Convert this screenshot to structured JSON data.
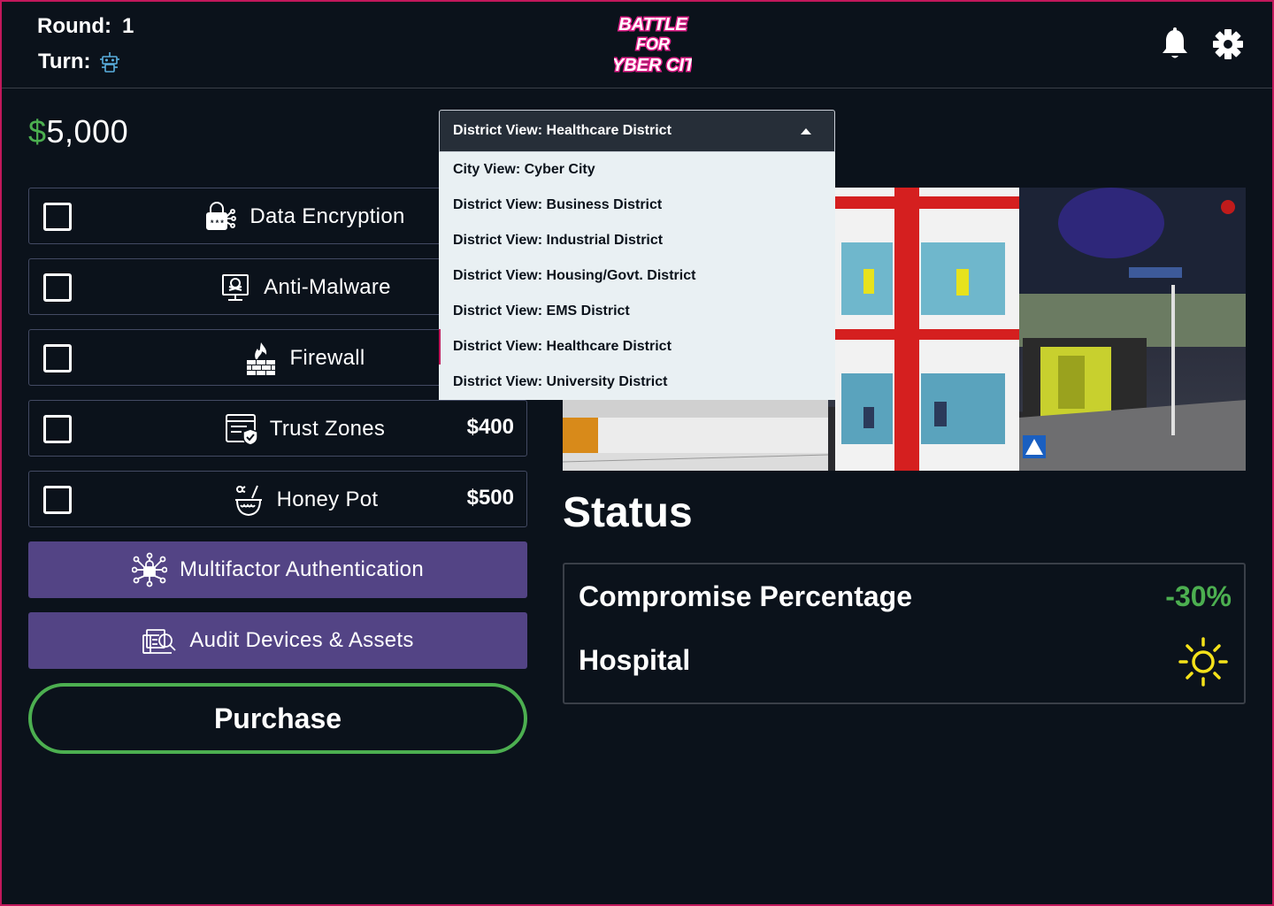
{
  "header": {
    "round_label": "Round:",
    "round_value": "1",
    "turn_label": "Turn:",
    "turn_icon": "robot-icon",
    "logo": {
      "line1": "BATTLE",
      "line2": "FOR",
      "line3": "CYBER CITY"
    },
    "notifications_icon": "bell-icon",
    "settings_icon": "gear-icon"
  },
  "wallet": {
    "currency_symbol": "$",
    "amount": "5,000"
  },
  "defenses": [
    {
      "label": "Data Encryption",
      "icon": "lock-icon",
      "price": "",
      "checked": false
    },
    {
      "label": "Anti-Malware",
      "icon": "monitor-skull-icon",
      "price": "",
      "checked": false
    },
    {
      "label": "Firewall",
      "icon": "firewall-icon",
      "price": "",
      "checked": false
    },
    {
      "label": "Trust Zones",
      "icon": "shield-window-icon",
      "price": "$400",
      "checked": false
    },
    {
      "label": "Honey Pot",
      "icon": "honey-pot-icon",
      "price": "$500",
      "checked": false
    }
  ],
  "actions": [
    {
      "label": "Multifactor Authentication",
      "icon": "network-lock-icon"
    },
    {
      "label": "Audit Devices & Assets",
      "icon": "audit-icon"
    }
  ],
  "purchase_label": "Purchase",
  "view_selector": {
    "selected": "District View: Healthcare  District",
    "options": [
      "City View: Cyber City",
      "District View: Business District",
      "District View: Industrial District",
      "District View: Housing/Govt.  District",
      "District View: EMS  District",
      "District View: Healthcare  District",
      "District View: University  District"
    ],
    "highlighted_index": 5
  },
  "status": {
    "title": "Status",
    "compromise_label": "Compromise Percentage",
    "compromise_value": "-30%",
    "facility_label": "Hospital",
    "facility_state_icon": "sun-icon"
  },
  "colors": {
    "background": "#0b121b",
    "accent_green": "#4caf50",
    "purple": "#534485",
    "frame_magenta": "#c2185b",
    "sun_yellow": "#f5e21a"
  }
}
